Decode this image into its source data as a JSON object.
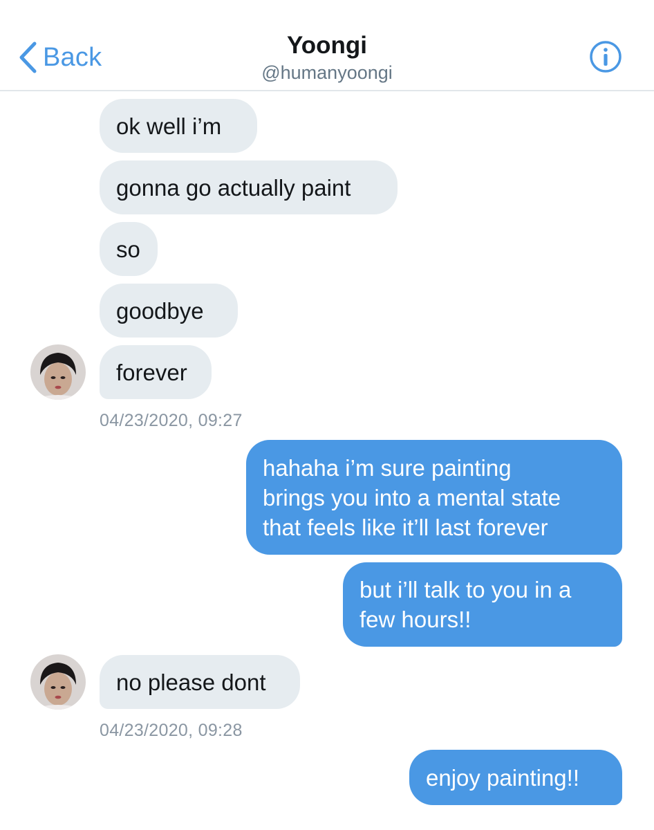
{
  "header": {
    "back_label": "Back",
    "title": "Yoongi",
    "handle": "@humanyoongi",
    "icons": {
      "back": "chevron-left-icon",
      "info": "info-circle-icon"
    },
    "accent": "#4a98e4"
  },
  "messages": [
    {
      "side": "in",
      "text": "ok well i’m"
    },
    {
      "side": "in",
      "text": "gonna go actually paint"
    },
    {
      "side": "in",
      "text": "so"
    },
    {
      "side": "in",
      "text": "goodbye"
    },
    {
      "side": "in",
      "text": "forever"
    },
    {
      "timestamp": "04/23/2020, 09:27"
    },
    {
      "side": "out",
      "lines": [
        "hahaha i’m sure painting",
        "brings you into a mental state",
        "that feels like it’ll last forever"
      ]
    },
    {
      "side": "out",
      "lines": [
        "but i’ll talk to you in a",
        "few hours!!"
      ]
    },
    {
      "side": "in",
      "text": "no please dont"
    },
    {
      "timestamp": "04/23/2020, 09:28"
    },
    {
      "side": "out",
      "lines": [
        "enjoy painting!!"
      ]
    }
  ],
  "colors": {
    "incoming_bubble": "#e6ecf0",
    "outgoing_bubble": "#4a98e4",
    "timestamp": "#8a96a2"
  }
}
